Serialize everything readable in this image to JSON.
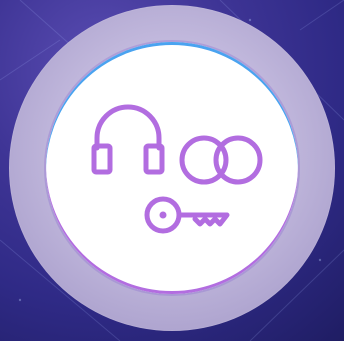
{
  "badge": {
    "icons": [
      "headphones-icon",
      "rings-icon",
      "key-icon"
    ],
    "colors": {
      "icon_stroke": "#b26de0",
      "inner_circle": "#ffffff",
      "top_edge": "#4aa3f0",
      "bottom_edge": "#b26de0",
      "outer_ring": "#c2b9dd",
      "background": "#2f2a86"
    }
  }
}
